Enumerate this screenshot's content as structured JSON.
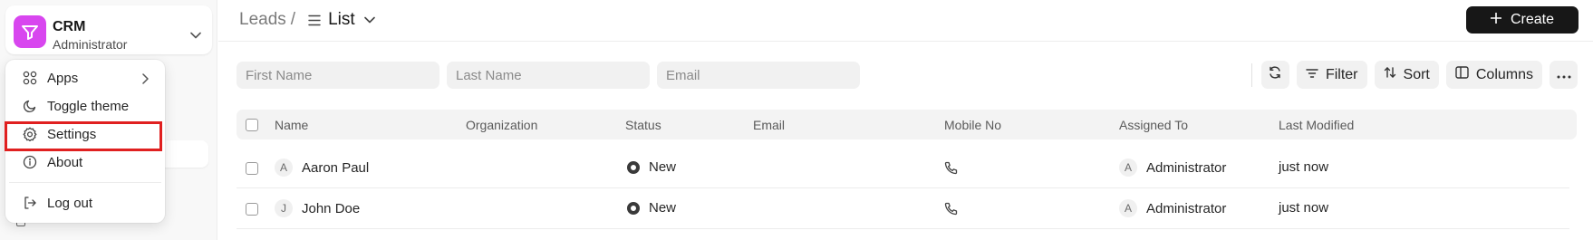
{
  "brand": {
    "name": "CRM",
    "role": "Administrator",
    "logo_color": "#d846ef"
  },
  "menu": {
    "items": [
      {
        "label": "Apps",
        "icon": "grid-icon"
      },
      {
        "label": "Toggle theme",
        "icon": "moon-icon"
      },
      {
        "label": "Settings",
        "icon": "gear-icon"
      },
      {
        "label": "About",
        "icon": "info-icon"
      },
      {
        "label": "Log out",
        "icon": "logout-icon"
      }
    ],
    "highlight_color": "#e02020"
  },
  "header": {
    "breadcrumb_parent": "Leads",
    "breadcrumb_sep": "/",
    "view_label": "List",
    "create_label": "Create"
  },
  "filters": {
    "first_name_placeholder": "First Name",
    "last_name_placeholder": "Last Name",
    "email_placeholder": "Email"
  },
  "toolbar": {
    "filter_label": "Filter",
    "sort_label": "Sort",
    "columns_label": "Columns"
  },
  "table": {
    "columns": [
      "Name",
      "Organization",
      "Status",
      "Email",
      "Mobile No",
      "Assigned To",
      "Last Modified"
    ],
    "rows": [
      {
        "initial": "A",
        "name": "Aaron Paul",
        "organization": "",
        "status": "New",
        "email": "",
        "assignee_initial": "A",
        "assigned_to": "Administrator",
        "last_modified": "just now"
      },
      {
        "initial": "J",
        "name": "John Doe",
        "organization": "",
        "status": "New",
        "email": "",
        "assignee_initial": "A",
        "assigned_to": "Administrator",
        "last_modified": "just now"
      }
    ]
  }
}
